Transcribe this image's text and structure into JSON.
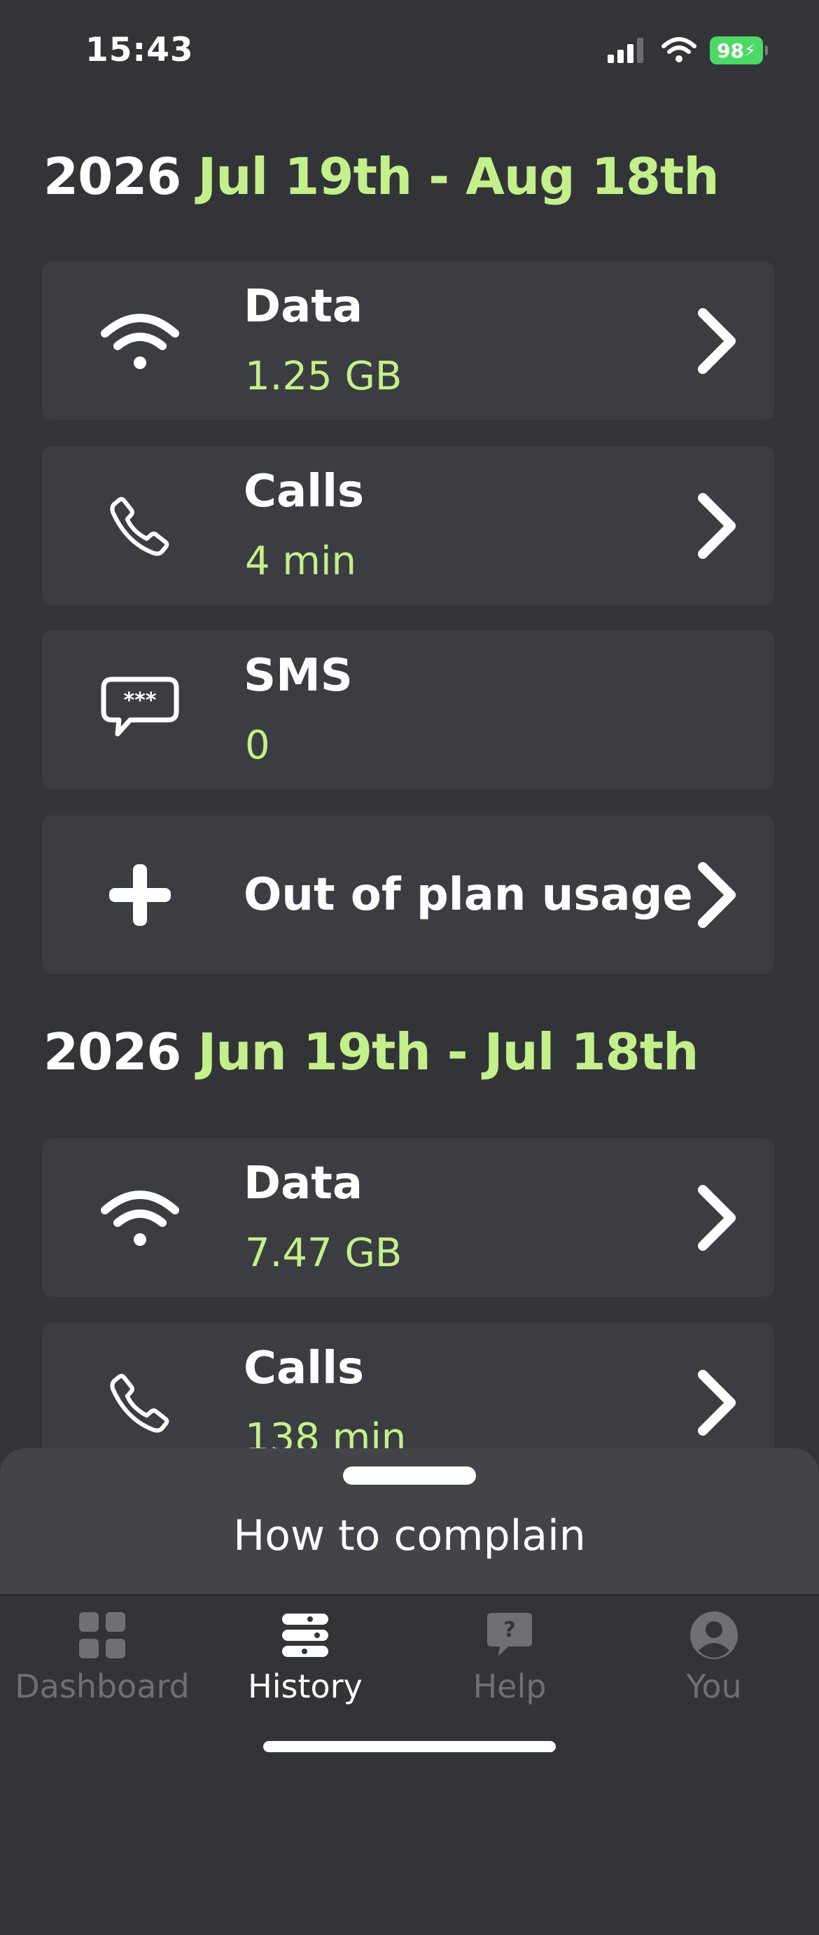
{
  "status_bar": {
    "time": "15:43",
    "battery": "98"
  },
  "periods": [
    {
      "year": "2026",
      "range": "Jul 19th - Aug 18th",
      "cards": [
        {
          "title": "Data",
          "value": "1.25 GB",
          "icon": "wifi-icon",
          "has_chevron": true
        },
        {
          "title": "Calls",
          "value": "4 min",
          "icon": "phone-icon",
          "has_chevron": true
        },
        {
          "title": "SMS",
          "value": "0",
          "icon": "message-bubble-icon",
          "has_chevron": false
        },
        {
          "title": "Out of plan usage",
          "icon": "plus-icon",
          "has_chevron": true
        }
      ]
    },
    {
      "year": "2026",
      "range": "Jun 19th - Jul 18th",
      "cards": [
        {
          "title": "Data",
          "value": "7.47 GB",
          "icon": "wifi-icon",
          "has_chevron": true
        },
        {
          "title": "Calls",
          "value": "138 min",
          "icon": "phone-icon",
          "has_chevron": true
        }
      ]
    }
  ],
  "bottom_sheet": {
    "title": "How to complain"
  },
  "tab_bar": {
    "tabs": [
      {
        "label": "Dashboard",
        "icon": "grid-icon",
        "active": false
      },
      {
        "label": "History",
        "icon": "history-list-icon",
        "active": true
      },
      {
        "label": "Help",
        "icon": "help-bubble-icon",
        "active": false
      },
      {
        "label": "You",
        "icon": "profile-icon",
        "active": false
      }
    ]
  },
  "colors": {
    "background": "#333438",
    "card": "#3c3d42",
    "accent": "#c3f08a",
    "inactive_tab": "#6f7075",
    "battery": "#4cd964"
  }
}
